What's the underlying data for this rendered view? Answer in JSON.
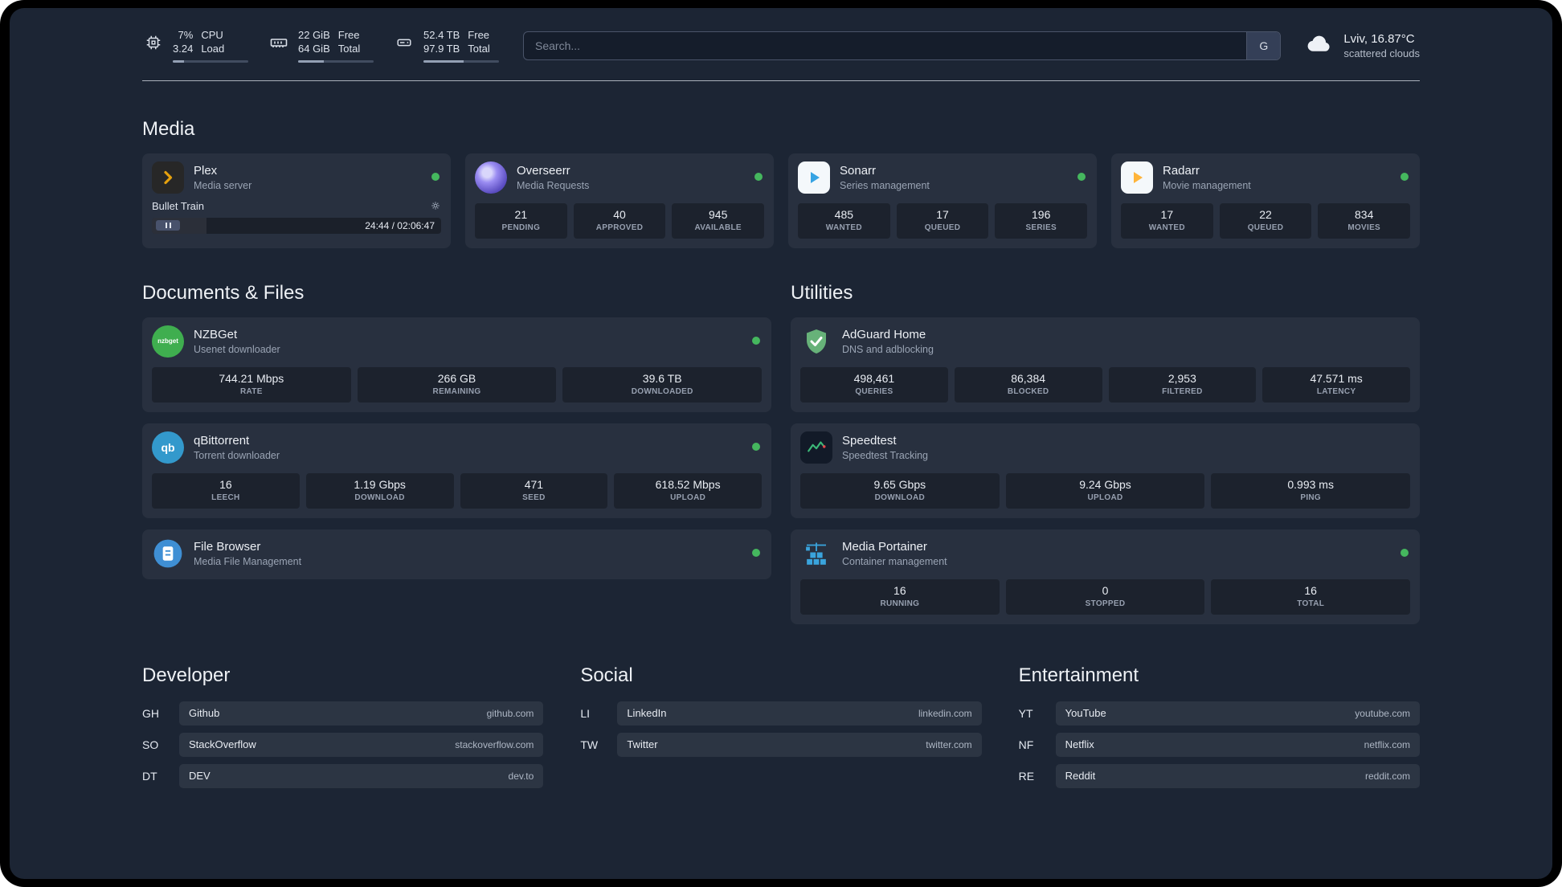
{
  "colors": {
    "status_online": "#45b75e",
    "plex": "#e5a00d",
    "sonarr": "#36a3e3",
    "radarr": "#ffb43a",
    "nzbget": "#3fae4f",
    "qbittorrent": "#3399cc",
    "filebrowser": "#3f8fd4",
    "adguard": "#67b279",
    "speedtest": "#3cb878",
    "portainer": "#3aa4dd"
  },
  "topbar": {
    "cpu": {
      "value1": "7%",
      "value2": "3.24",
      "label1": "CPU",
      "label2": "Load",
      "bar_pct": 15
    },
    "ram": {
      "value1": "22 GiB",
      "value2": "64 GiB",
      "label1": "Free",
      "label2": "Total",
      "bar_pct": 34
    },
    "disk": {
      "value1": "52.4 TB",
      "value2": "97.9 TB",
      "label1": "Free",
      "label2": "Total",
      "bar_pct": 53
    },
    "search": {
      "placeholder": "Search...",
      "button": "G"
    },
    "weather": {
      "location": "Lviv, 16.87°C",
      "condition": "scattered clouds"
    }
  },
  "sections": {
    "media": {
      "title": "Media",
      "plex": {
        "name": "Plex",
        "desc": "Media server",
        "online": true,
        "player": {
          "track": "Bullet Train",
          "time": "24:44 / 02:06:47",
          "progress_pct": 19
        }
      },
      "overseerr": {
        "name": "Overseerr",
        "desc": "Media Requests",
        "online": true,
        "stats": [
          {
            "value": "21",
            "label": "PENDING"
          },
          {
            "value": "40",
            "label": "APPROVED"
          },
          {
            "value": "945",
            "label": "AVAILABLE"
          }
        ]
      },
      "sonarr": {
        "name": "Sonarr",
        "desc": "Series management",
        "online": true,
        "stats": [
          {
            "value": "485",
            "label": "WANTED"
          },
          {
            "value": "17",
            "label": "QUEUED"
          },
          {
            "value": "196",
            "label": "SERIES"
          }
        ]
      },
      "radarr": {
        "name": "Radarr",
        "desc": "Movie management",
        "online": true,
        "stats": [
          {
            "value": "17",
            "label": "WANTED"
          },
          {
            "value": "22",
            "label": "QUEUED"
          },
          {
            "value": "834",
            "label": "MOVIES"
          }
        ]
      }
    },
    "documents": {
      "title": "Documents & Files",
      "nzbget": {
        "name": "NZBGet",
        "desc": "Usenet downloader",
        "online": true,
        "icon_text": "nzbget",
        "stats": [
          {
            "value": "744.21 Mbps",
            "label": "RATE"
          },
          {
            "value": "266 GB",
            "label": "REMAINING"
          },
          {
            "value": "39.6 TB",
            "label": "DOWNLOADED"
          }
        ]
      },
      "qbittorrent": {
        "name": "qBittorrent",
        "desc": "Torrent downloader",
        "online": true,
        "icon_text": "qb",
        "stats": [
          {
            "value": "16",
            "label": "LEECH"
          },
          {
            "value": "1.19 Gbps",
            "label": "DOWNLOAD"
          },
          {
            "value": "471",
            "label": "SEED"
          },
          {
            "value": "618.52 Mbps",
            "label": "UPLOAD"
          }
        ]
      },
      "filebrowser": {
        "name": "File Browser",
        "desc": "Media File Management",
        "online": true
      }
    },
    "utilities": {
      "title": "Utilities",
      "adguard": {
        "name": "AdGuard Home",
        "desc": "DNS and adblocking",
        "stats": [
          {
            "value": "498,461",
            "label": "QUERIES"
          },
          {
            "value": "86,384",
            "label": "BLOCKED"
          },
          {
            "value": "2,953",
            "label": "FILTERED"
          },
          {
            "value": "47.571 ms",
            "label": "LATENCY"
          }
        ]
      },
      "speedtest": {
        "name": "Speedtest",
        "desc": "Speedtest Tracking",
        "stats": [
          {
            "value": "9.65 Gbps",
            "label": "DOWNLOAD"
          },
          {
            "value": "9.24 Gbps",
            "label": "UPLOAD"
          },
          {
            "value": "0.993 ms",
            "label": "PING"
          }
        ]
      },
      "portainer": {
        "name": "Media Portainer",
        "desc": "Container management",
        "online": true,
        "stats": [
          {
            "value": "16",
            "label": "RUNNING"
          },
          {
            "value": "0",
            "label": "STOPPED"
          },
          {
            "value": "16",
            "label": "TOTAL"
          }
        ]
      }
    }
  },
  "bookmarks": {
    "developer": {
      "title": "Developer",
      "items": [
        {
          "abbr": "GH",
          "name": "Github",
          "url": "github.com"
        },
        {
          "abbr": "SO",
          "name": "StackOverflow",
          "url": "stackoverflow.com"
        },
        {
          "abbr": "DT",
          "name": "DEV",
          "url": "dev.to"
        }
      ]
    },
    "social": {
      "title": "Social",
      "items": [
        {
          "abbr": "LI",
          "name": "LinkedIn",
          "url": "linkedin.com"
        },
        {
          "abbr": "TW",
          "name": "Twitter",
          "url": "twitter.com"
        }
      ]
    },
    "entertainment": {
      "title": "Entertainment",
      "items": [
        {
          "abbr": "YT",
          "name": "YouTube",
          "url": "youtube.com"
        },
        {
          "abbr": "NF",
          "name": "Netflix",
          "url": "netflix.com"
        },
        {
          "abbr": "RE",
          "name": "Reddit",
          "url": "reddit.com"
        }
      ]
    }
  }
}
